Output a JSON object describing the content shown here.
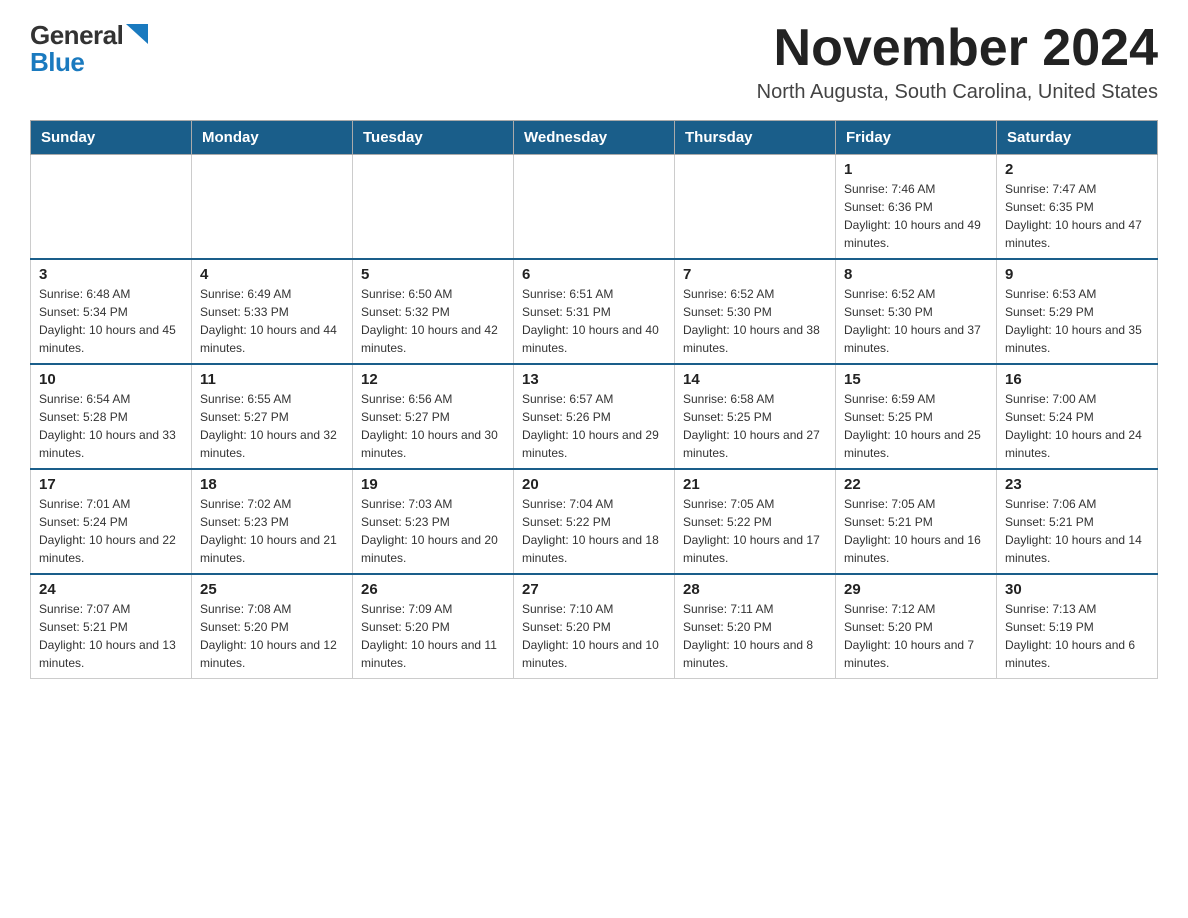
{
  "header": {
    "logo_general": "General",
    "logo_blue": "Blue",
    "title": "November 2024",
    "subtitle": "North Augusta, South Carolina, United States"
  },
  "calendar": {
    "days_of_week": [
      "Sunday",
      "Monday",
      "Tuesday",
      "Wednesday",
      "Thursday",
      "Friday",
      "Saturday"
    ],
    "weeks": [
      {
        "days": [
          {
            "number": "",
            "info": ""
          },
          {
            "number": "",
            "info": ""
          },
          {
            "number": "",
            "info": ""
          },
          {
            "number": "",
            "info": ""
          },
          {
            "number": "",
            "info": ""
          },
          {
            "number": "1",
            "info": "Sunrise: 7:46 AM\nSunset: 6:36 PM\nDaylight: 10 hours and 49 minutes."
          },
          {
            "number": "2",
            "info": "Sunrise: 7:47 AM\nSunset: 6:35 PM\nDaylight: 10 hours and 47 minutes."
          }
        ]
      },
      {
        "days": [
          {
            "number": "3",
            "info": "Sunrise: 6:48 AM\nSunset: 5:34 PM\nDaylight: 10 hours and 45 minutes."
          },
          {
            "number": "4",
            "info": "Sunrise: 6:49 AM\nSunset: 5:33 PM\nDaylight: 10 hours and 44 minutes."
          },
          {
            "number": "5",
            "info": "Sunrise: 6:50 AM\nSunset: 5:32 PM\nDaylight: 10 hours and 42 minutes."
          },
          {
            "number": "6",
            "info": "Sunrise: 6:51 AM\nSunset: 5:31 PM\nDaylight: 10 hours and 40 minutes."
          },
          {
            "number": "7",
            "info": "Sunrise: 6:52 AM\nSunset: 5:30 PM\nDaylight: 10 hours and 38 minutes."
          },
          {
            "number": "8",
            "info": "Sunrise: 6:52 AM\nSunset: 5:30 PM\nDaylight: 10 hours and 37 minutes."
          },
          {
            "number": "9",
            "info": "Sunrise: 6:53 AM\nSunset: 5:29 PM\nDaylight: 10 hours and 35 minutes."
          }
        ]
      },
      {
        "days": [
          {
            "number": "10",
            "info": "Sunrise: 6:54 AM\nSunset: 5:28 PM\nDaylight: 10 hours and 33 minutes."
          },
          {
            "number": "11",
            "info": "Sunrise: 6:55 AM\nSunset: 5:27 PM\nDaylight: 10 hours and 32 minutes."
          },
          {
            "number": "12",
            "info": "Sunrise: 6:56 AM\nSunset: 5:27 PM\nDaylight: 10 hours and 30 minutes."
          },
          {
            "number": "13",
            "info": "Sunrise: 6:57 AM\nSunset: 5:26 PM\nDaylight: 10 hours and 29 minutes."
          },
          {
            "number": "14",
            "info": "Sunrise: 6:58 AM\nSunset: 5:25 PM\nDaylight: 10 hours and 27 minutes."
          },
          {
            "number": "15",
            "info": "Sunrise: 6:59 AM\nSunset: 5:25 PM\nDaylight: 10 hours and 25 minutes."
          },
          {
            "number": "16",
            "info": "Sunrise: 7:00 AM\nSunset: 5:24 PM\nDaylight: 10 hours and 24 minutes."
          }
        ]
      },
      {
        "days": [
          {
            "number": "17",
            "info": "Sunrise: 7:01 AM\nSunset: 5:24 PM\nDaylight: 10 hours and 22 minutes."
          },
          {
            "number": "18",
            "info": "Sunrise: 7:02 AM\nSunset: 5:23 PM\nDaylight: 10 hours and 21 minutes."
          },
          {
            "number": "19",
            "info": "Sunrise: 7:03 AM\nSunset: 5:23 PM\nDaylight: 10 hours and 20 minutes."
          },
          {
            "number": "20",
            "info": "Sunrise: 7:04 AM\nSunset: 5:22 PM\nDaylight: 10 hours and 18 minutes."
          },
          {
            "number": "21",
            "info": "Sunrise: 7:05 AM\nSunset: 5:22 PM\nDaylight: 10 hours and 17 minutes."
          },
          {
            "number": "22",
            "info": "Sunrise: 7:05 AM\nSunset: 5:21 PM\nDaylight: 10 hours and 16 minutes."
          },
          {
            "number": "23",
            "info": "Sunrise: 7:06 AM\nSunset: 5:21 PM\nDaylight: 10 hours and 14 minutes."
          }
        ]
      },
      {
        "days": [
          {
            "number": "24",
            "info": "Sunrise: 7:07 AM\nSunset: 5:21 PM\nDaylight: 10 hours and 13 minutes."
          },
          {
            "number": "25",
            "info": "Sunrise: 7:08 AM\nSunset: 5:20 PM\nDaylight: 10 hours and 12 minutes."
          },
          {
            "number": "26",
            "info": "Sunrise: 7:09 AM\nSunset: 5:20 PM\nDaylight: 10 hours and 11 minutes."
          },
          {
            "number": "27",
            "info": "Sunrise: 7:10 AM\nSunset: 5:20 PM\nDaylight: 10 hours and 10 minutes."
          },
          {
            "number": "28",
            "info": "Sunrise: 7:11 AM\nSunset: 5:20 PM\nDaylight: 10 hours and 8 minutes."
          },
          {
            "number": "29",
            "info": "Sunrise: 7:12 AM\nSunset: 5:20 PM\nDaylight: 10 hours and 7 minutes."
          },
          {
            "number": "30",
            "info": "Sunrise: 7:13 AM\nSunset: 5:19 PM\nDaylight: 10 hours and 6 minutes."
          }
        ]
      }
    ]
  }
}
